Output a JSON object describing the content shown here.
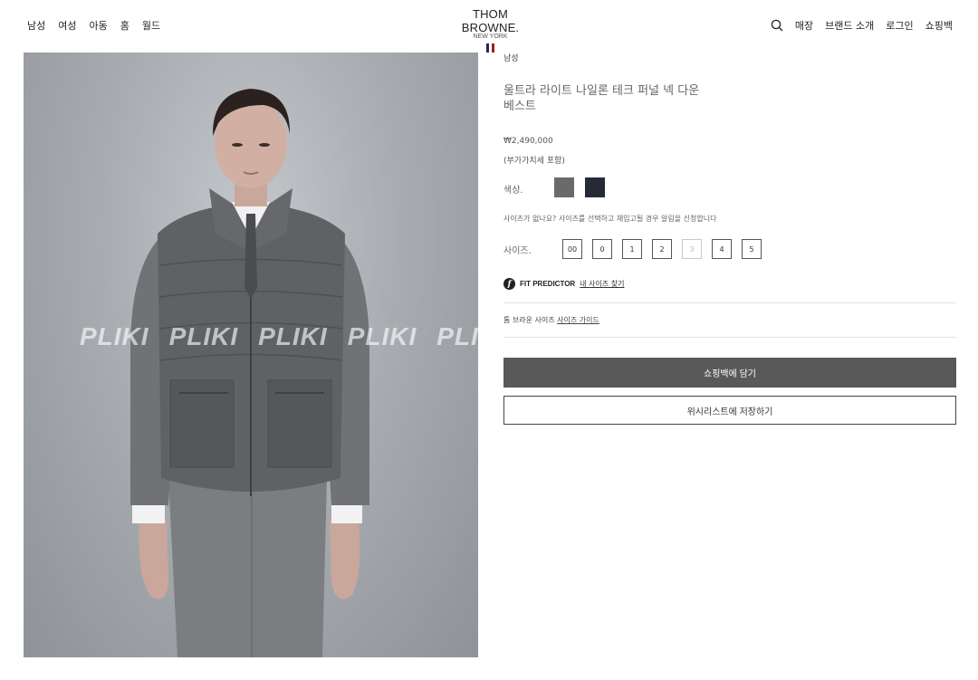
{
  "header": {
    "nav_left": [
      "남성",
      "여성",
      "아동",
      "홈",
      "월드"
    ],
    "logo": {
      "name": "THOM BROWNE.",
      "sub": "NEW YORK",
      "flag_colors": [
        "#1f2a55",
        "#ffffff",
        "#a61c2b"
      ]
    },
    "nav_right": [
      "매장",
      "브랜드 소개",
      "로그인",
      "쇼핑백"
    ],
    "search_icon": "search-icon"
  },
  "product": {
    "image_watermark": [
      "PLIKI",
      "PLIKI",
      "PLIKI",
      "PLIKI",
      "PLI"
    ],
    "category": "남성",
    "title": "울트라 라이트 나일론 테크 퍼널 넥 다운 베스트",
    "price": "₩2,490,000",
    "vat_note": "(부가가치세 포함)",
    "color_label": "색상.",
    "colors": [
      "#6a6a6a",
      "#262a36"
    ],
    "size_note": "사이즈가 없나요? 사이즈를 선택하고 재입고될 경우 알림을 신청합니다",
    "size_label": "사이즈.",
    "sizes": [
      {
        "label": "00",
        "available": true
      },
      {
        "label": "0",
        "available": true
      },
      {
        "label": "1",
        "available": true
      },
      {
        "label": "2",
        "available": true
      },
      {
        "label": "3",
        "available": false
      },
      {
        "label": "4",
        "available": true
      },
      {
        "label": "5",
        "available": true
      }
    ],
    "fit_predictor": {
      "icon": "f",
      "brand": "FIT PREDICTOR",
      "link": "내 사이즈 찾기"
    },
    "size_guide": {
      "text": "톰 브라운 사이즈",
      "link": "사이즈 가이드"
    },
    "add_to_bag": "쇼핑백에 담기",
    "add_to_wishlist": "위시리스트에 저장하기"
  }
}
